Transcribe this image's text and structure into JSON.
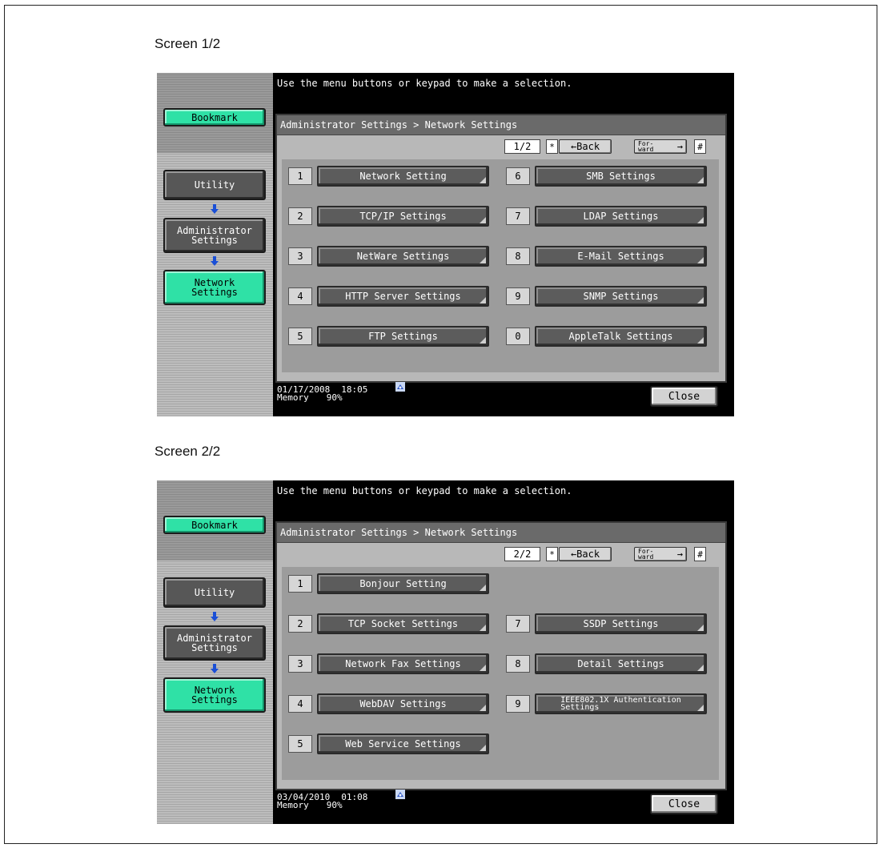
{
  "screens": [
    {
      "caption": "Screen 1/2",
      "left_panel": {
        "bookmark": "Bookmark",
        "utility": "Utility",
        "administrator": "Administrator\nSettings",
        "network": "Network\nSettings"
      },
      "message": "Use the menu buttons or keypad to make a selection.",
      "breadcrumb": "Administrator Settings > Network Settings",
      "page_indicator": "1/2",
      "star_key": "*",
      "back_label": "←Back",
      "forward_label": "For-\nward",
      "forward_arrow": "→",
      "hash_key": "#",
      "buttons_left": [
        {
          "num": "1",
          "label": "Network Setting"
        },
        {
          "num": "2",
          "label": "TCP/IP Settings"
        },
        {
          "num": "3",
          "label": "NetWare Settings"
        },
        {
          "num": "4",
          "label": "HTTP Server Settings"
        },
        {
          "num": "5",
          "label": "FTP Settings"
        }
      ],
      "buttons_right": [
        {
          "num": "6",
          "label": "SMB Settings"
        },
        {
          "num": "7",
          "label": "LDAP Settings"
        },
        {
          "num": "8",
          "label": "E-Mail Settings"
        },
        {
          "num": "9",
          "label": "SNMP Settings"
        },
        {
          "num": "0",
          "label": "AppleTalk Settings"
        }
      ],
      "date": "01/17/2008",
      "time": "18:05",
      "memory_label": "Memory",
      "memory_value": "90%",
      "close_label": "Close"
    },
    {
      "caption": "Screen 2/2",
      "left_panel": {
        "bookmark": "Bookmark",
        "utility": "Utility",
        "administrator": "Administrator\nSettings",
        "network": "Network\nSettings"
      },
      "message": "Use the menu buttons or keypad to make a selection.",
      "breadcrumb": "Administrator Settings > Network Settings",
      "page_indicator": "2/2",
      "star_key": "*",
      "back_label": "←Back",
      "forward_label": "For-\nward",
      "forward_arrow": "→",
      "hash_key": "#",
      "buttons_left": [
        {
          "num": "1",
          "label": "Bonjour Setting"
        },
        {
          "num": "2",
          "label": "TCP Socket Settings"
        },
        {
          "num": "3",
          "label": "Network Fax Settings"
        },
        {
          "num": "4",
          "label": "WebDAV Settings"
        },
        {
          "num": "5",
          "label": "Web Service Settings"
        }
      ],
      "buttons_right": [
        null,
        {
          "num": "7",
          "label": "SSDP Settings"
        },
        {
          "num": "8",
          "label": "Detail Settings"
        },
        {
          "num": "9",
          "label": "IEEE802.1X Authentication\nSettings"
        },
        null
      ],
      "date": "03/04/2010",
      "time": "01:08",
      "memory_label": "Memory",
      "memory_value": "90%",
      "close_label": "Close"
    }
  ],
  "colors": {
    "green_button": "#2fe1a6",
    "dark_button": "#575757",
    "arrow_blue": "#1a4fd6"
  },
  "icons": {
    "down_arrow": "down-arrow-icon",
    "network_status": "network-status-icon"
  }
}
